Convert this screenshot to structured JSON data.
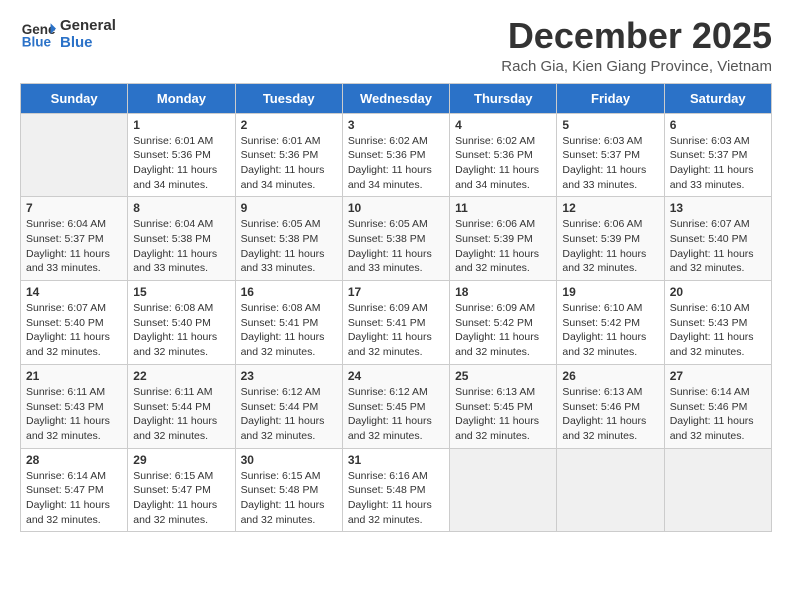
{
  "header": {
    "logo_line1": "General",
    "logo_line2": "Blue",
    "month_year": "December 2025",
    "subtitle": "Rach Gia, Kien Giang Province, Vietnam"
  },
  "days_of_week": [
    "Sunday",
    "Monday",
    "Tuesday",
    "Wednesday",
    "Thursday",
    "Friday",
    "Saturday"
  ],
  "weeks": [
    [
      {
        "day": "",
        "sunrise": "",
        "sunset": "",
        "daylight": "",
        "empty": true
      },
      {
        "day": "1",
        "sunrise": "6:01 AM",
        "sunset": "5:36 PM",
        "daylight": "11 hours and 34 minutes."
      },
      {
        "day": "2",
        "sunrise": "6:01 AM",
        "sunset": "5:36 PM",
        "daylight": "11 hours and 34 minutes."
      },
      {
        "day": "3",
        "sunrise": "6:02 AM",
        "sunset": "5:36 PM",
        "daylight": "11 hours and 34 minutes."
      },
      {
        "day": "4",
        "sunrise": "6:02 AM",
        "sunset": "5:36 PM",
        "daylight": "11 hours and 34 minutes."
      },
      {
        "day": "5",
        "sunrise": "6:03 AM",
        "sunset": "5:37 PM",
        "daylight": "11 hours and 33 minutes."
      },
      {
        "day": "6",
        "sunrise": "6:03 AM",
        "sunset": "5:37 PM",
        "daylight": "11 hours and 33 minutes."
      }
    ],
    [
      {
        "day": "7",
        "sunrise": "6:04 AM",
        "sunset": "5:37 PM",
        "daylight": "11 hours and 33 minutes."
      },
      {
        "day": "8",
        "sunrise": "6:04 AM",
        "sunset": "5:38 PM",
        "daylight": "11 hours and 33 minutes."
      },
      {
        "day": "9",
        "sunrise": "6:05 AM",
        "sunset": "5:38 PM",
        "daylight": "11 hours and 33 minutes."
      },
      {
        "day": "10",
        "sunrise": "6:05 AM",
        "sunset": "5:38 PM",
        "daylight": "11 hours and 33 minutes."
      },
      {
        "day": "11",
        "sunrise": "6:06 AM",
        "sunset": "5:39 PM",
        "daylight": "11 hours and 32 minutes."
      },
      {
        "day": "12",
        "sunrise": "6:06 AM",
        "sunset": "5:39 PM",
        "daylight": "11 hours and 32 minutes."
      },
      {
        "day": "13",
        "sunrise": "6:07 AM",
        "sunset": "5:40 PM",
        "daylight": "11 hours and 32 minutes."
      }
    ],
    [
      {
        "day": "14",
        "sunrise": "6:07 AM",
        "sunset": "5:40 PM",
        "daylight": "11 hours and 32 minutes."
      },
      {
        "day": "15",
        "sunrise": "6:08 AM",
        "sunset": "5:40 PM",
        "daylight": "11 hours and 32 minutes."
      },
      {
        "day": "16",
        "sunrise": "6:08 AM",
        "sunset": "5:41 PM",
        "daylight": "11 hours and 32 minutes."
      },
      {
        "day": "17",
        "sunrise": "6:09 AM",
        "sunset": "5:41 PM",
        "daylight": "11 hours and 32 minutes."
      },
      {
        "day": "18",
        "sunrise": "6:09 AM",
        "sunset": "5:42 PM",
        "daylight": "11 hours and 32 minutes."
      },
      {
        "day": "19",
        "sunrise": "6:10 AM",
        "sunset": "5:42 PM",
        "daylight": "11 hours and 32 minutes."
      },
      {
        "day": "20",
        "sunrise": "6:10 AM",
        "sunset": "5:43 PM",
        "daylight": "11 hours and 32 minutes."
      }
    ],
    [
      {
        "day": "21",
        "sunrise": "6:11 AM",
        "sunset": "5:43 PM",
        "daylight": "11 hours and 32 minutes."
      },
      {
        "day": "22",
        "sunrise": "6:11 AM",
        "sunset": "5:44 PM",
        "daylight": "11 hours and 32 minutes."
      },
      {
        "day": "23",
        "sunrise": "6:12 AM",
        "sunset": "5:44 PM",
        "daylight": "11 hours and 32 minutes."
      },
      {
        "day": "24",
        "sunrise": "6:12 AM",
        "sunset": "5:45 PM",
        "daylight": "11 hours and 32 minutes."
      },
      {
        "day": "25",
        "sunrise": "6:13 AM",
        "sunset": "5:45 PM",
        "daylight": "11 hours and 32 minutes."
      },
      {
        "day": "26",
        "sunrise": "6:13 AM",
        "sunset": "5:46 PM",
        "daylight": "11 hours and 32 minutes."
      },
      {
        "day": "27",
        "sunrise": "6:14 AM",
        "sunset": "5:46 PM",
        "daylight": "11 hours and 32 minutes."
      }
    ],
    [
      {
        "day": "28",
        "sunrise": "6:14 AM",
        "sunset": "5:47 PM",
        "daylight": "11 hours and 32 minutes."
      },
      {
        "day": "29",
        "sunrise": "6:15 AM",
        "sunset": "5:47 PM",
        "daylight": "11 hours and 32 minutes."
      },
      {
        "day": "30",
        "sunrise": "6:15 AM",
        "sunset": "5:48 PM",
        "daylight": "11 hours and 32 minutes."
      },
      {
        "day": "31",
        "sunrise": "6:16 AM",
        "sunset": "5:48 PM",
        "daylight": "11 hours and 32 minutes."
      },
      {
        "day": "",
        "sunrise": "",
        "sunset": "",
        "daylight": "",
        "empty": true
      },
      {
        "day": "",
        "sunrise": "",
        "sunset": "",
        "daylight": "",
        "empty": true
      },
      {
        "day": "",
        "sunrise": "",
        "sunset": "",
        "daylight": "",
        "empty": true
      }
    ]
  ],
  "labels": {
    "sunrise_prefix": "Sunrise: ",
    "sunset_prefix": "Sunset: ",
    "daylight_prefix": "Daylight: "
  }
}
